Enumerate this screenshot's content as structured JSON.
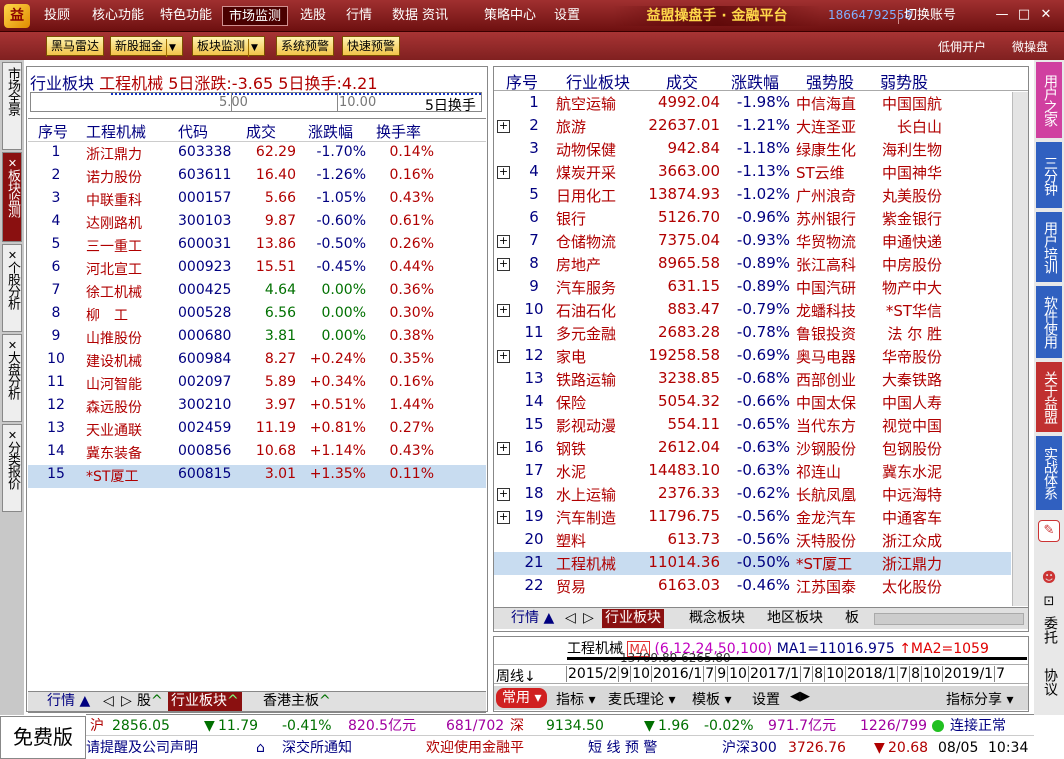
{
  "menu": [
    "投顾",
    "核心功能",
    "特色功能",
    "市场监测",
    "选股",
    "行情",
    "数据",
    "资讯",
    "策略中心",
    "设置"
  ],
  "brand": "益盟操盘手 · 金融平台",
  "phone": "18664792558",
  "switch_account": "切换账号",
  "win": {
    "min": "—",
    "max": "□",
    "close": "✕"
  },
  "toolbar": [
    "黑马雷达",
    "新股掘金",
    "板块监测",
    "系统预警",
    "快速预警"
  ],
  "toolbar_right": [
    "低佣开户",
    "微操盘"
  ],
  "left_tabs": [
    "市场全景",
    "板块监测",
    "个股分析",
    "大盘分析",
    "分类报价"
  ],
  "right_tabs": [
    {
      "label": "用户之家",
      "color": "#d040a0"
    },
    {
      "label": "三分钟",
      "color": "#3060c0"
    },
    {
      "label": "用户培训",
      "color": "#3060c0"
    },
    {
      "label": "软件使用",
      "color": "#3060c0"
    },
    {
      "label": "关于益盟",
      "color": "#c03030"
    },
    {
      "label": "实战体系",
      "color": "#3060c0"
    }
  ],
  "right_side_items": [
    "委托",
    "协议"
  ],
  "left_panel": {
    "header": {
      "sector": "行业板块",
      "name": "工程机械",
      "chg5": "5日涨跌:-3.65",
      "turn5": "5日换手:4.21"
    },
    "scale": {
      "a": "5.00",
      "b": "10.00",
      "label": "5日换手"
    },
    "columns": [
      "序号",
      "工程机械",
      "代码",
      "成交",
      "涨跌幅",
      "换手率"
    ],
    "rows": [
      [
        "1",
        "浙江鼎力",
        "603338",
        "62.29",
        "-1.70%",
        "0.14%"
      ],
      [
        "2",
        "诺力股份",
        "603611",
        "16.40",
        "-1.26%",
        "0.16%"
      ],
      [
        "3",
        "中联重科",
        "000157",
        "5.66",
        "-1.05%",
        "0.43%"
      ],
      [
        "4",
        "达刚路机",
        "300103",
        "9.87",
        "-0.60%",
        "0.61%"
      ],
      [
        "5",
        "三一重工",
        "600031",
        "13.86",
        "-0.50%",
        "0.26%"
      ],
      [
        "6",
        "河北宣工",
        "000923",
        "15.51",
        "-0.45%",
        "0.44%"
      ],
      [
        "7",
        "徐工机械",
        "000425",
        "4.64",
        "0.00%",
        "0.36%"
      ],
      [
        "8",
        "柳　工",
        "000528",
        "6.56",
        "0.00%",
        "0.30%"
      ],
      [
        "9",
        "山推股份",
        "000680",
        "3.81",
        "0.00%",
        "0.38%"
      ],
      [
        "10",
        "建设机械",
        "600984",
        "8.27",
        "+0.24%",
        "0.35%"
      ],
      [
        "11",
        "山河智能",
        "002097",
        "5.89",
        "+0.34%",
        "0.16%"
      ],
      [
        "12",
        "森远股份",
        "300210",
        "3.97",
        "+0.51%",
        "1.44%"
      ],
      [
        "13",
        "天业通联",
        "002459",
        "11.19",
        "+0.81%",
        "0.27%"
      ],
      [
        "14",
        "冀东装备",
        "000856",
        "10.68",
        "+1.14%",
        "0.43%"
      ],
      [
        "15",
        "*ST厦工",
        "600815",
        "3.01",
        "+1.35%",
        "0.11%"
      ]
    ],
    "tabs": [
      "行情",
      "股",
      "行业板块",
      "香港主板"
    ]
  },
  "right_panel": {
    "columns": [
      "序号",
      "行业板块",
      "成交",
      "涨跌幅",
      "强势股",
      "弱势股"
    ],
    "rows": [
      [
        "1",
        "航空运输",
        "4992.04",
        "-1.98%",
        "中信海直",
        "中国国航",
        false
      ],
      [
        "2",
        "旅游",
        "22637.01",
        "-1.21%",
        "大连圣亚",
        "长白山",
        true
      ],
      [
        "3",
        "动物保健",
        "942.84",
        "-1.18%",
        "绿康生化",
        "海利生物",
        false
      ],
      [
        "4",
        "煤炭开采",
        "3663.00",
        "-1.13%",
        "ST云维",
        "中国神华",
        true
      ],
      [
        "5",
        "日用化工",
        "13874.93",
        "-1.02%",
        "广州浪奇",
        "丸美股份",
        false
      ],
      [
        "6",
        "银行",
        "5126.70",
        "-0.96%",
        "苏州银行",
        "紫金银行",
        false
      ],
      [
        "7",
        "仓储物流",
        "7375.04",
        "-0.93%",
        "华贸物流",
        "申通快递",
        true
      ],
      [
        "8",
        "房地产",
        "8965.58",
        "-0.89%",
        "张江高科",
        "中房股份",
        true
      ],
      [
        "9",
        "汽车服务",
        "631.15",
        "-0.89%",
        "中国汽研",
        "物产中大",
        false
      ],
      [
        "10",
        "石油石化",
        "883.47",
        "-0.79%",
        "龙蟠科技",
        "*ST华信",
        true
      ],
      [
        "11",
        "多元金融",
        "2683.28",
        "-0.78%",
        "鲁银投资",
        "法 尔 胜",
        false
      ],
      [
        "12",
        "家电",
        "19258.58",
        "-0.69%",
        "奥马电器",
        "华帝股份",
        true
      ],
      [
        "13",
        "铁路运输",
        "3238.85",
        "-0.68%",
        "西部创业",
        "大秦铁路",
        false
      ],
      [
        "14",
        "保险",
        "5054.32",
        "-0.66%",
        "中国太保",
        "中国人寿",
        false
      ],
      [
        "15",
        "影视动漫",
        "554.11",
        "-0.65%",
        "当代东方",
        "视觉中国",
        false
      ],
      [
        "16",
        "钢铁",
        "2612.04",
        "-0.63%",
        "沙钢股份",
        "包钢股份",
        true
      ],
      [
        "17",
        "水泥",
        "14483.10",
        "-0.63%",
        "祁连山",
        "冀东水泥",
        false
      ],
      [
        "18",
        "水上运输",
        "2376.33",
        "-0.62%",
        "长航凤凰",
        "中远海特",
        true
      ],
      [
        "19",
        "汽车制造",
        "11796.75",
        "-0.56%",
        "金龙汽车",
        "中通客车",
        true
      ],
      [
        "20",
        "塑料",
        "613.73",
        "-0.56%",
        "沃特股份",
        "浙江众成",
        false
      ],
      [
        "21",
        "工程机械",
        "11014.36",
        "-0.50%",
        "*ST厦工",
        "浙江鼎力",
        false
      ],
      [
        "22",
        "贸易",
        "6163.03",
        "-0.46%",
        "江苏国泰",
        "太化股份",
        false
      ]
    ],
    "tabs": [
      "行情",
      "行业板块",
      "概念板块",
      "地区板块",
      "板"
    ]
  },
  "kline": {
    "name": "工程机械",
    "ma_label": "MA",
    "ma_params": "(6,12,24,50,100)",
    "ma1": "MA1=11016.975",
    "ma2": "MA2=1059",
    "overlap": "13709.80 6265.80",
    "period": "周线",
    "dates": [
      "2015/2",
      "9",
      "10",
      "2016/1",
      "7",
      "9",
      "10",
      "2017/1",
      "7",
      "8",
      "10",
      "2018/1",
      "7",
      "8",
      "10",
      "2019/1",
      "7"
    ],
    "bottom": [
      "常用",
      "指标",
      "麦氏理论",
      "模板",
      "设置",
      "指标分享"
    ]
  },
  "status": {
    "free": "免费版",
    "sh": {
      "name": "沪",
      "idx": "2856.05",
      "chg": "11.79",
      "pct": "-0.41%",
      "amt": "820.5亿元",
      "updown": "681/702"
    },
    "sz": {
      "name": "深",
      "idx": "9134.50",
      "chg": "1.96",
      "pct": "-0.02%",
      "amt": "971.7亿元",
      "updown": "1226/799"
    },
    "conn": "连接正常",
    "notice1": "请提醒及公司声明",
    "notice2": "深交所通知",
    "notice3": "欢迎使用金融平",
    "notice4": "短 线 预 警",
    "hs300": {
      "name": "沪深300",
      "idx": "3726.76",
      "chg": "20.68"
    },
    "date": "08/05",
    "time": "10:34"
  },
  "colors": {
    "up": "#b00000",
    "down": "#007000",
    "header": "#000080",
    "select": "#c8dcf0"
  }
}
